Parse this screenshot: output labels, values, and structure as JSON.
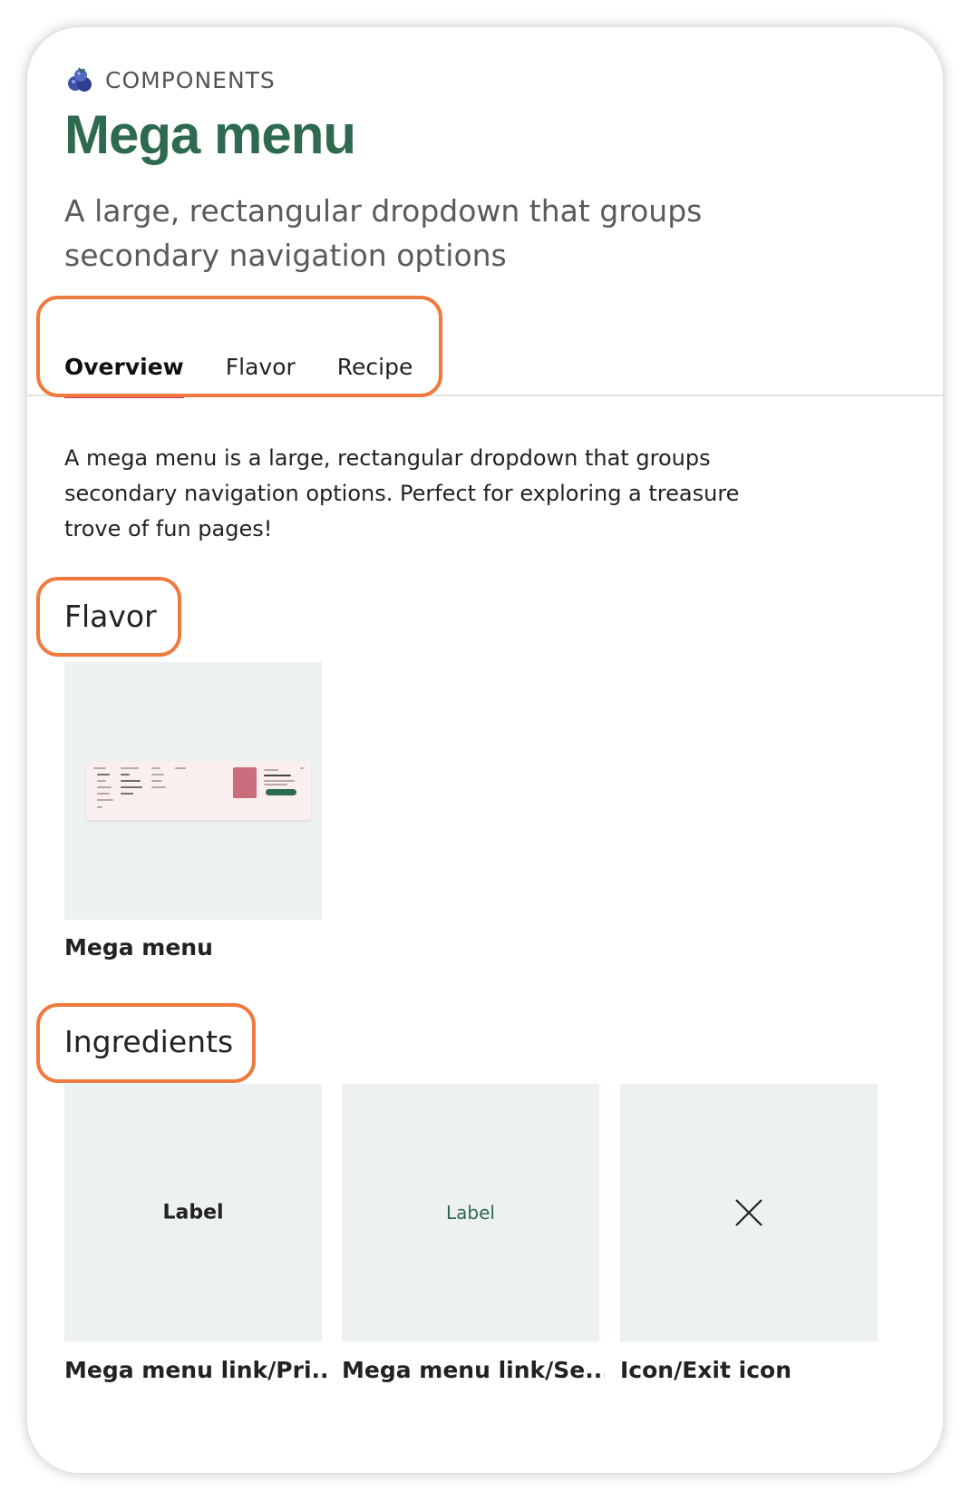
{
  "header": {
    "eyebrow": "COMPONENTS",
    "eyebrow_icon": "blueberries-icon",
    "title": "Mega menu",
    "subtitle": "A large, rectangular dropdown that groups secondary navigation options"
  },
  "tabs": [
    {
      "label": "Overview",
      "active": true
    },
    {
      "label": "Flavor",
      "active": false
    },
    {
      "label": "Recipe",
      "active": false
    }
  ],
  "description": "A mega menu is a large, rectangular dropdown that groups secondary navigation options. Perfect for exploring a treasure trove of fun pages!",
  "flavor": {
    "title": "Flavor",
    "items": [
      {
        "caption": "Mega menu"
      }
    ]
  },
  "ingredients": {
    "title": "Ingredients",
    "items": [
      {
        "caption": "Mega menu link/Pri...",
        "preview_label": "Label"
      },
      {
        "caption": "Mega menu link/Se...",
        "preview_label": "Label"
      },
      {
        "caption": "Icon/Exit icon",
        "preview_icon": "close-icon"
      }
    ]
  },
  "colors": {
    "accent_green": "#2d6a4f",
    "tab_underline": "#d6336c",
    "highlight_outline": "#f07a3d"
  }
}
